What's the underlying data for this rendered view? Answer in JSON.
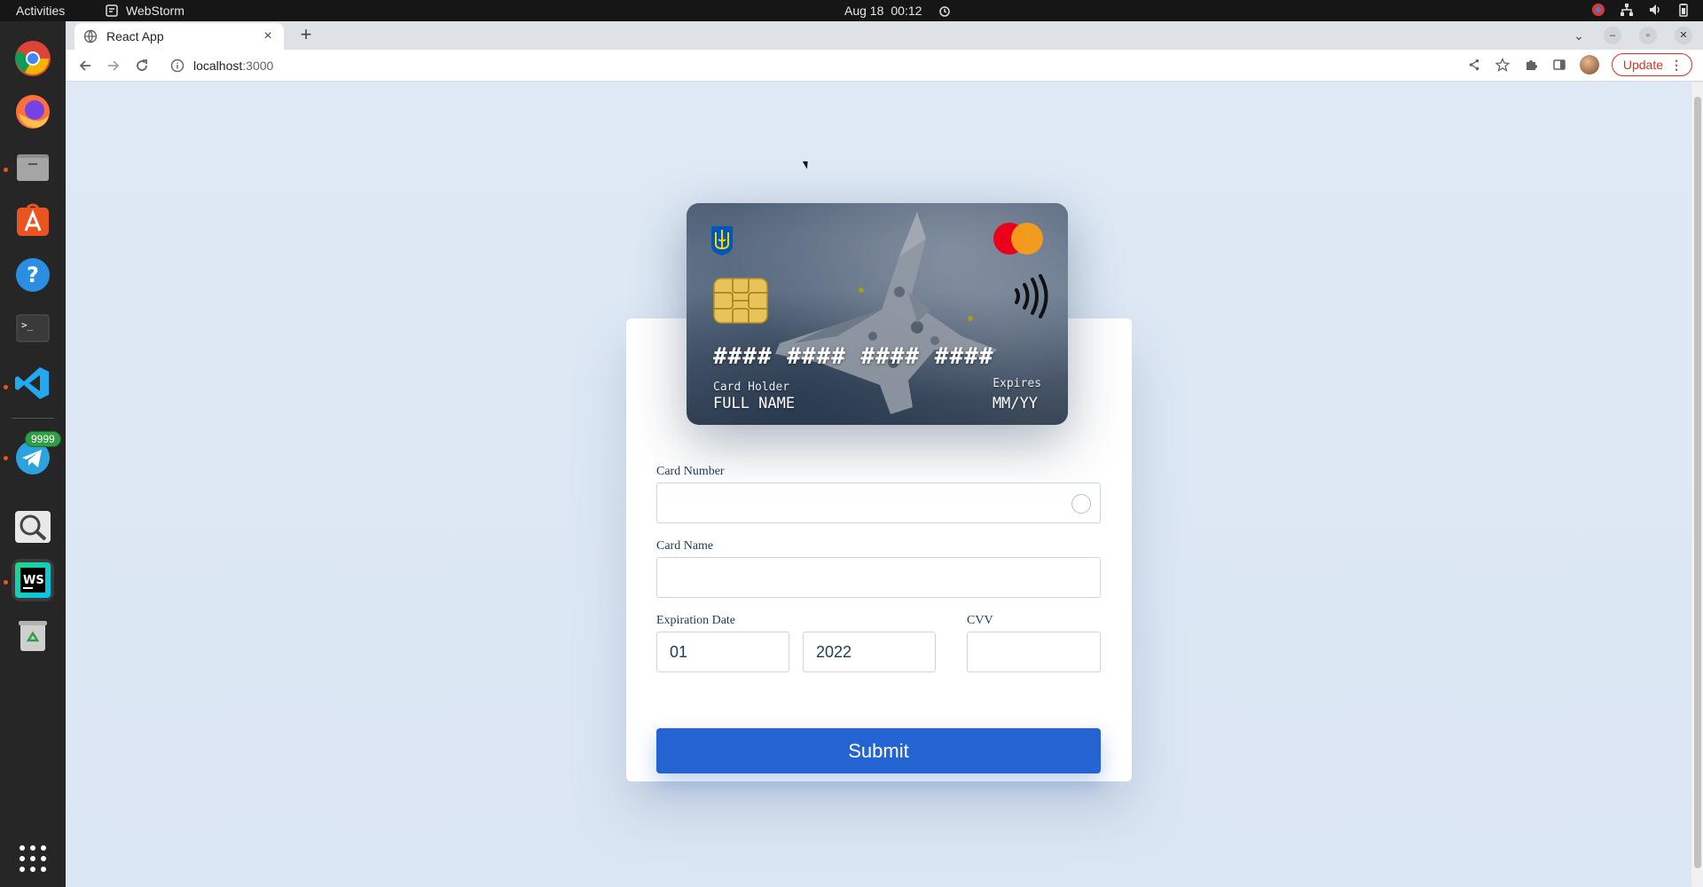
{
  "system_bar": {
    "activities": "Activities",
    "app_name": "WebStorm",
    "date": "Aug 18",
    "time": "00:12"
  },
  "dock": {
    "apps": [
      "chrome-icon",
      "firefox-icon",
      "files-icon",
      "app-center-icon",
      "help-icon",
      "terminal-icon",
      "vscode-icon",
      "telegram-icon",
      "search-icon",
      "webstorm-icon",
      "trash-icon",
      "show-apps-icon"
    ],
    "telegram_badge": "9999"
  },
  "browser": {
    "tab_title": "React App",
    "address_host": "localhost",
    "address_port": ":3000",
    "update_label": "Update"
  },
  "card_preview": {
    "number": "#### #### #### ####",
    "holder_label": "Card Holder",
    "holder_value": "FULL NAME",
    "expires_label": "Expires",
    "expires_value": "MM/YY"
  },
  "form": {
    "card_number_label": "Card Number",
    "card_number_value": "",
    "card_name_label": "Card Name",
    "card_name_value": "",
    "expiration_label": "Expiration Date",
    "month_value": "01",
    "year_value": "2022",
    "cvv_label": "CVV",
    "cvv_value": "",
    "submit_label": "Submit"
  },
  "colors": {
    "submit": "#2364d2",
    "page_background": "#dfe9f5",
    "label_text": "#1a3b5d"
  }
}
